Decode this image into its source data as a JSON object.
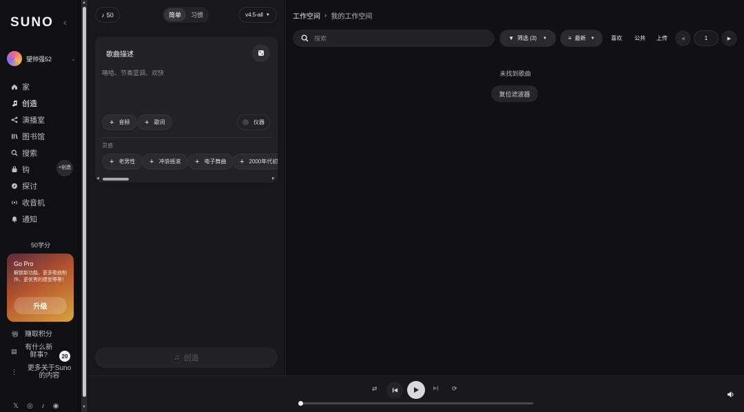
{
  "sidebar": {
    "logo": "SUNO",
    "collapse": "‹",
    "username": "望帅强52",
    "nav": [
      {
        "label": "家",
        "icon": "home-icon"
      },
      {
        "label": "创造",
        "icon": "music-note-icon",
        "active": true
      },
      {
        "label": "演播室",
        "icon": "studio-icon"
      },
      {
        "label": "图书馆",
        "icon": "library-icon"
      },
      {
        "label": "搜索",
        "icon": "search-icon"
      },
      {
        "label": "钩",
        "icon": "hook-icon"
      },
      {
        "label": "探讨",
        "icon": "explore-icon"
      },
      {
        "label": "收音机",
        "icon": "radio-icon"
      },
      {
        "label": "通知",
        "icon": "bell-icon"
      }
    ],
    "create_pill": "+创造",
    "credits": "50学分",
    "gopro": {
      "title": "Go Pro",
      "desc": "解锁新功能、更多歌曲制作、更优秀的模型等等！",
      "button": "升级"
    },
    "bottom": [
      {
        "label": "赚取积分",
        "icon": "gift-icon"
      },
      {
        "label": "有什么新鲜事?",
        "icon": "news-icon",
        "badge": "20"
      },
      {
        "label": "更多关于Suno的内容",
        "icon": "more-vertical-icon"
      }
    ]
  },
  "create": {
    "credits_chip": "50",
    "tabs": [
      "简单",
      "习惯"
    ],
    "active_tab": "简单",
    "version": "v4.5-all",
    "card": {
      "title": "歌曲描述",
      "placeholder": "嘻哈、节奏蓝调、欢快",
      "audio": "音频",
      "lyrics": "歌词",
      "instrumental": "仪器"
    },
    "inspiration_label": "灵感",
    "inspiration": [
      "老男性",
      "冲浪摇滚",
      "电子舞曲",
      "2000年代初"
    ],
    "create_button": "创造"
  },
  "workspace": {
    "breadcrumb_root": "工作空间",
    "breadcrumb_current": "我的工作空间",
    "search_placeholder": "搜索",
    "filter": "筛选 (3)",
    "sort": "最新",
    "liked": "喜欢",
    "public": "公共",
    "upload": "上传",
    "page": "1",
    "empty": "未找到歌曲",
    "reset": "复位滤波器"
  },
  "player": {
    "progress": 0
  }
}
